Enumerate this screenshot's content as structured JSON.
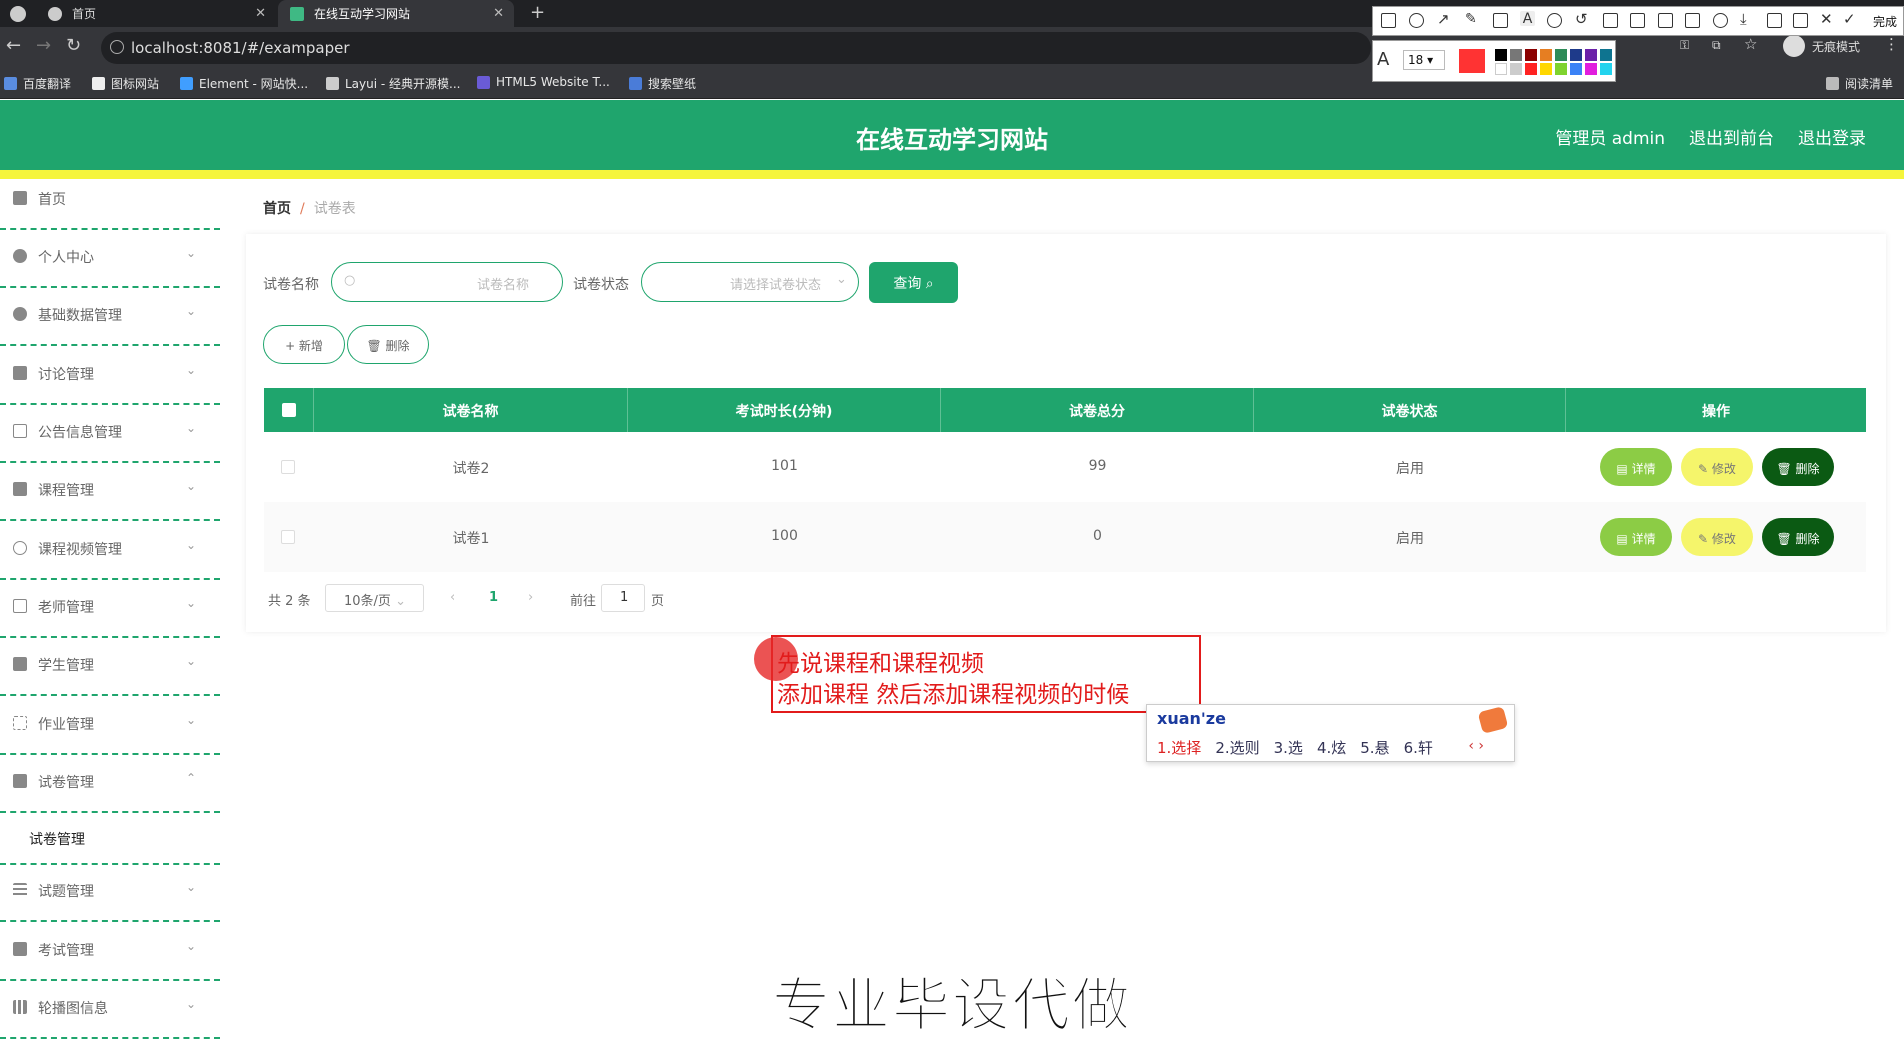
{
  "browser": {
    "tabs": [
      {
        "label": "首页"
      },
      {
        "label": "在线互动学习网站"
      }
    ],
    "url": "localhost:8081/#/exampaper",
    "profile": "无痕模式",
    "reading_list": "阅读清单",
    "bookmarks": [
      "百度翻译",
      "图标网站",
      "Element - 网站快...",
      "Layui - 经典开源模...",
      "HTML5 Website T...",
      "搜索壁纸"
    ]
  },
  "annot_toolbar": {
    "done": "完成",
    "font_size": "18",
    "pen_color": "#ff3333"
  },
  "header": {
    "title": "在线互动学习网站",
    "admin": "管理员 admin",
    "to_front": "退出到前台",
    "logout": "退出登录",
    "color": "#1fa56d"
  },
  "sidebar": {
    "items": [
      {
        "label": "首页",
        "icon": "home-icon"
      },
      {
        "label": "个人中心",
        "icon": "user-icon"
      },
      {
        "label": "基础数据管理",
        "icon": "user-icon"
      },
      {
        "label": "讨论管理",
        "icon": "grid-icon"
      },
      {
        "label": "公告信息管理",
        "icon": "copy-icon"
      },
      {
        "label": "课程管理",
        "icon": "flag-icon"
      },
      {
        "label": "课程视频管理",
        "icon": "video-icon"
      },
      {
        "label": "老师管理",
        "icon": "id-card-icon"
      },
      {
        "label": "学生管理",
        "icon": "briefcase-icon"
      },
      {
        "label": "作业管理",
        "icon": "expand-icon"
      },
      {
        "label": "试卷管理",
        "icon": "delete-doc-icon"
      },
      {
        "label": "试题管理",
        "icon": "list-icon"
      },
      {
        "label": "考试管理",
        "icon": "ticket-icon"
      },
      {
        "label": "轮播图信息",
        "icon": "bar-chart-icon"
      }
    ],
    "submenu": "试卷管理"
  },
  "breadcrumb": {
    "home": "首页",
    "sep": "/",
    "current": "试卷表"
  },
  "search": {
    "name_label": "试卷名称",
    "name_placeholder": "试卷名称",
    "status_label": "试卷状态",
    "status_placeholder": "请选择试卷状态",
    "query_button": "查询"
  },
  "actions": {
    "add": "+ 新增",
    "delete": "删除"
  },
  "table": {
    "headers": [
      "试卷名称",
      "考试时长(分钟)",
      "试卷总分",
      "试卷状态",
      "操作"
    ],
    "rows": [
      {
        "name": "试卷2",
        "duration": "101",
        "score": "99",
        "status": "启用"
      },
      {
        "name": "试卷1",
        "duration": "100",
        "score": "0",
        "status": "启用"
      }
    ],
    "row_buttons": {
      "detail": "详情",
      "edit": "修改",
      "delete": "删除"
    }
  },
  "pagination": {
    "total": "共 2 条",
    "page_size": "10条/页",
    "current": "1",
    "goto_label": "前往",
    "goto_value": "1",
    "page_suffix": "页"
  },
  "annotation": {
    "line1": "先说课程和课程视频",
    "line2": "添加课程 然后添加课程视频的时候"
  },
  "ime": {
    "pinyin": "xuan'ze",
    "candidates": [
      "1.选择",
      "2.选则",
      "3.选",
      "4.炫",
      "5.悬",
      "6.轩"
    ]
  },
  "watermark": "专业毕设代做"
}
